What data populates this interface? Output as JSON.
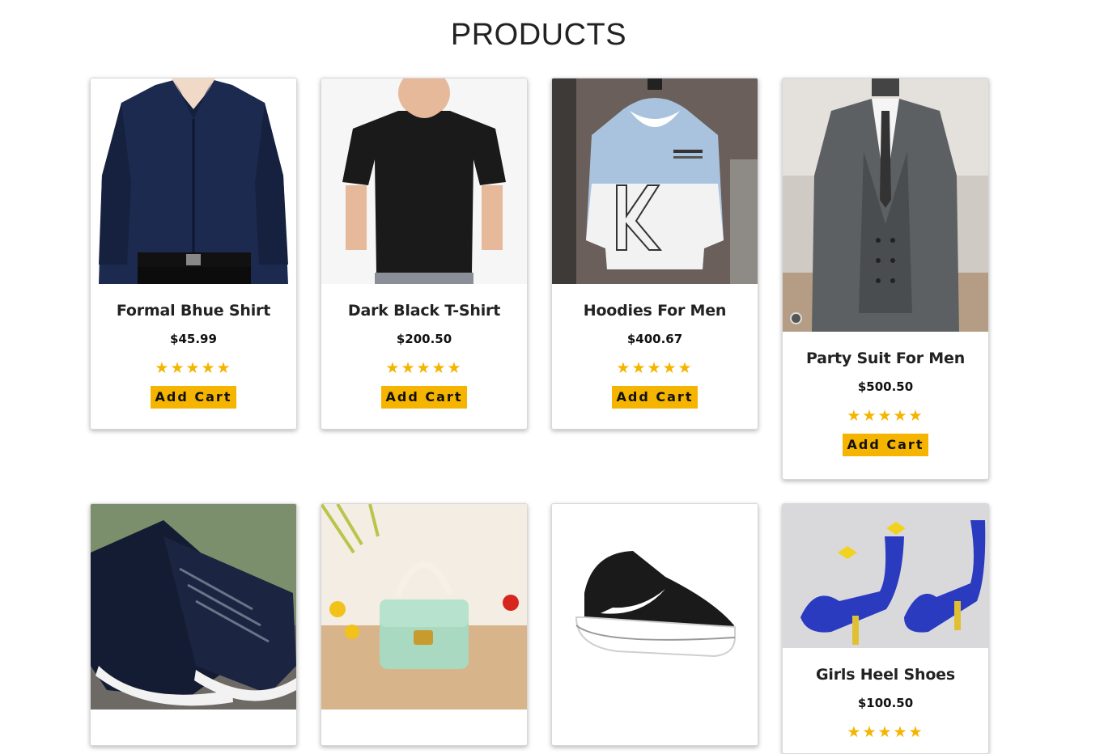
{
  "page": {
    "title": "PRODUCTS"
  },
  "colors": {
    "accent": "#f5b400",
    "text": "#222222"
  },
  "products": [
    {
      "name": "Formal Bhue Shirt",
      "price": "$45.99",
      "rating": 5,
      "stars": "★★★★★",
      "button": "Add Cart",
      "image": "navy-dress-shirt"
    },
    {
      "name": "Dark Black T-Shirt",
      "price": "$200.50",
      "rating": 5,
      "stars": "★★★★★",
      "button": "Add Cart",
      "image": "black-tshirt"
    },
    {
      "name": "Hoodies For Men",
      "price": "$400.67",
      "rating": 5,
      "stars": "★★★★★",
      "button": "Add Cart",
      "image": "blue-white-hoodie"
    },
    {
      "name": "Party Suit For Men",
      "price": "$500.50",
      "rating": 5,
      "stars": "★★★★★",
      "button": "Add Cart",
      "image": "grey-three-piece-suit"
    },
    {
      "image": "black-white-sneakers"
    },
    {
      "image": "green-pearl-handbag"
    },
    {
      "image": "black-nike-shoe"
    },
    {
      "name": "Girls Heel Shoes",
      "price": "$100.50",
      "rating": 5,
      "stars": "★★★★★",
      "image": "blue-high-heels"
    }
  ]
}
